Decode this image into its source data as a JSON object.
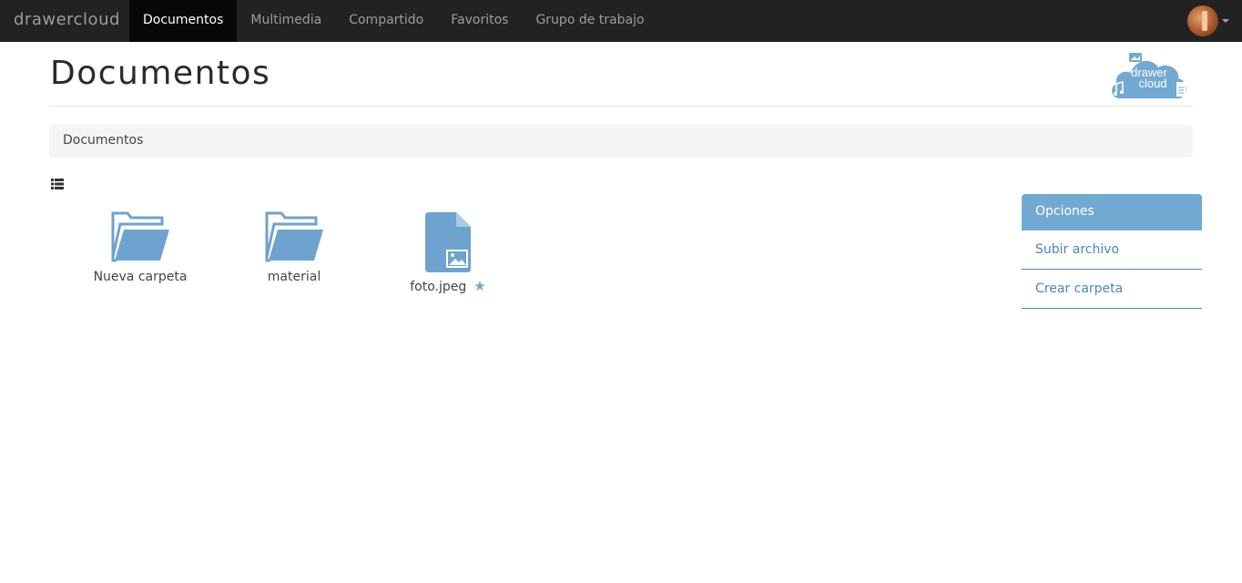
{
  "navbar": {
    "brand": "drawercloud",
    "items": [
      {
        "label": "Documentos",
        "active": true
      },
      {
        "label": "Multimedia",
        "active": false
      },
      {
        "label": "Compartido",
        "active": false
      },
      {
        "label": "Favoritos",
        "active": false
      },
      {
        "label": "Grupo de trabajo",
        "active": false
      }
    ]
  },
  "header": {
    "title": "Documentos",
    "logo_line1": "drawer",
    "logo_line2": "cloud"
  },
  "breadcrumb": {
    "current": "Documentos"
  },
  "files": [
    {
      "name": "Nueva carpeta",
      "type": "folder",
      "favorite": false
    },
    {
      "name": "material",
      "type": "folder",
      "favorite": false
    },
    {
      "name": "foto.jpeg",
      "type": "image",
      "favorite": true
    }
  ],
  "side_menu": {
    "title": "Opciones",
    "upload_label": "Subir archivo",
    "create_folder_label": "Crear carpeta"
  },
  "colors": {
    "navbar_bg": "#222222",
    "accent": "#72a9d2",
    "link": "#4a86b8",
    "icon": "#6fa3cf"
  }
}
